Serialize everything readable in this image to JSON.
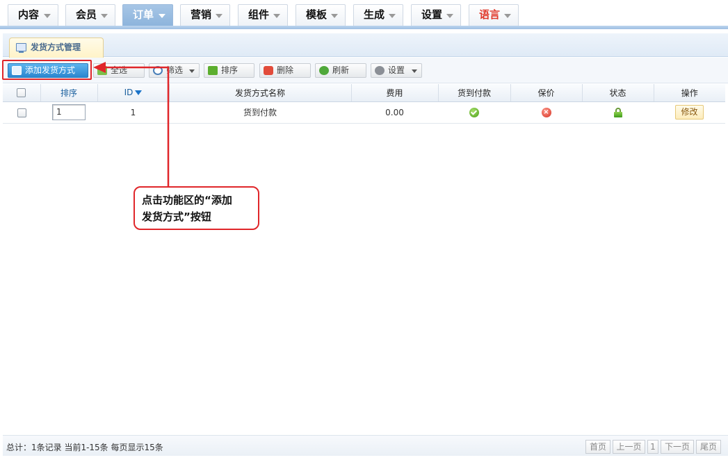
{
  "nav": {
    "items": [
      {
        "label": "内容"
      },
      {
        "label": "会员"
      },
      {
        "label": "订单"
      },
      {
        "label": "营销"
      },
      {
        "label": "组件"
      },
      {
        "label": "模板"
      },
      {
        "label": "生成"
      },
      {
        "label": "设置"
      },
      {
        "label": "语言"
      }
    ],
    "active_index": 2
  },
  "tab": {
    "label": "发货方式管理"
  },
  "toolbar": {
    "add": "添加发货方式",
    "select_all": "全选",
    "filter": "筛选",
    "sort": "排序",
    "delete": "删除",
    "refresh": "刷新",
    "settings": "设置"
  },
  "table": {
    "headers": {
      "sort": "排序",
      "id": "ID",
      "name": "发货方式名称",
      "fee": "费用",
      "cod": "货到付款",
      "insured": "保价",
      "status": "状态",
      "action": "操作"
    },
    "rows": [
      {
        "sort": "1",
        "id": "1",
        "name": "货到付款",
        "fee": "0.00",
        "cod": true,
        "insured": false,
        "status": "unlocked",
        "action": "修改"
      }
    ]
  },
  "callout": {
    "line1": "点击功能区的“添加",
    "line2": "发货方式”按钮"
  },
  "footer": {
    "summary": "总计：1条记录 当前1-15条 每页显示15条",
    "pager": {
      "first": "首页",
      "prev": "上一页",
      "current": "1",
      "next": "下一页",
      "last": "尾页"
    }
  },
  "colors": {
    "accent": "#2b86cf",
    "highlight": "#e0262a",
    "nav_active": "#9ebfe2"
  }
}
